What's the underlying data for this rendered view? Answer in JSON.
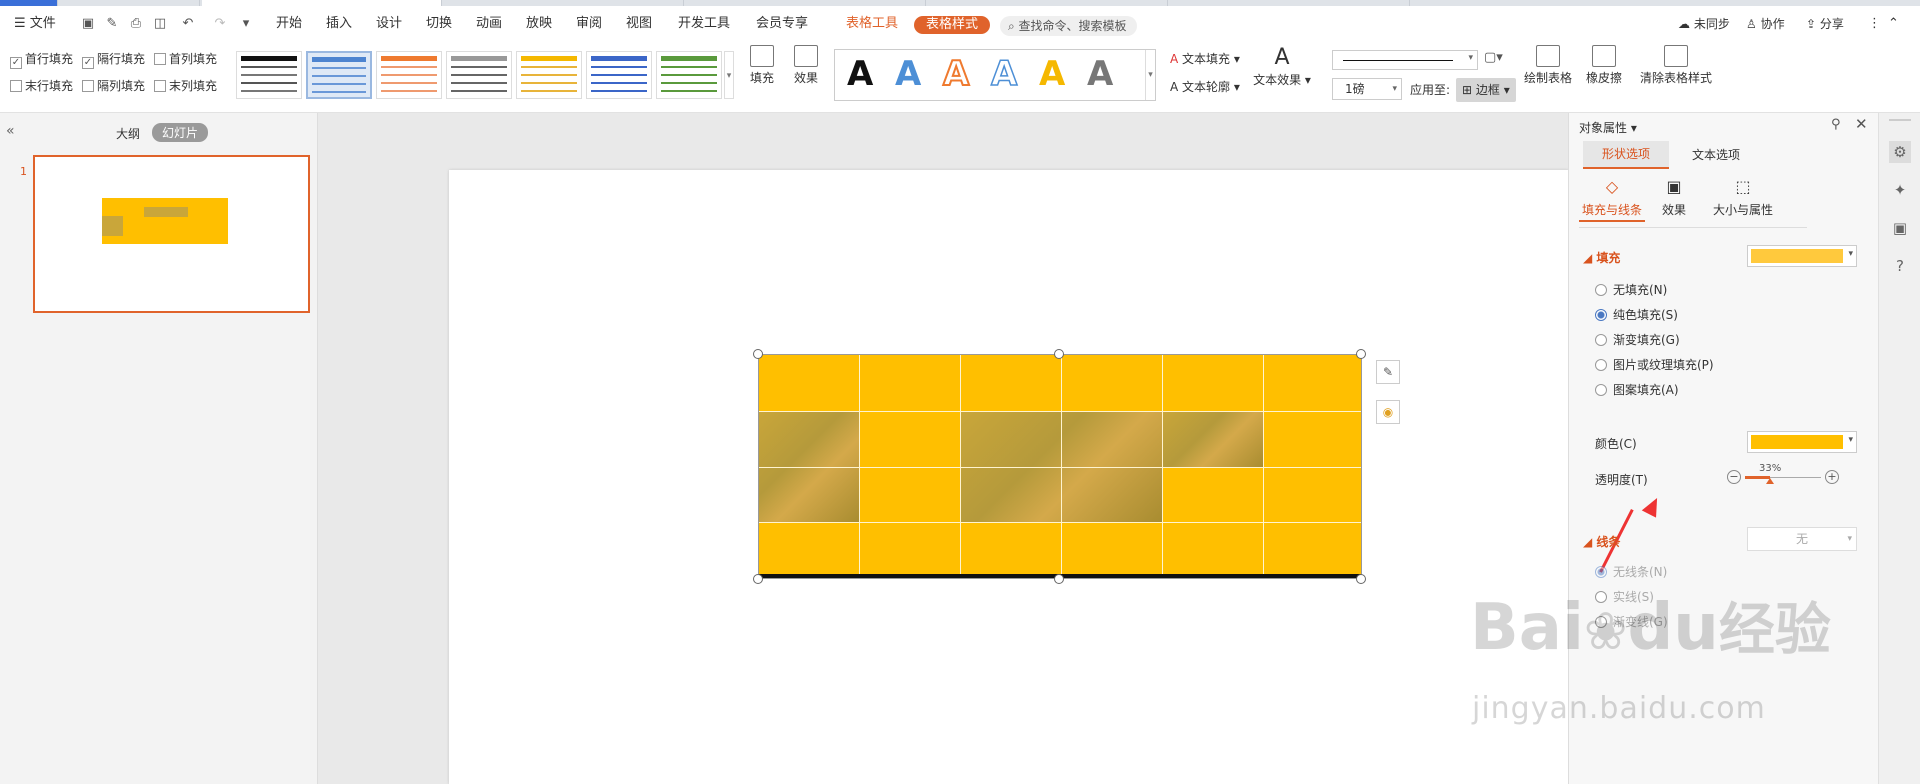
{
  "menu": {
    "file": "文件",
    "items": [
      "开始",
      "插入",
      "设计",
      "切换",
      "动画",
      "放映",
      "审阅",
      "视图",
      "开发工具",
      "会员专享"
    ],
    "table_tools": "表格工具",
    "table_style": "表格样式",
    "search": "查找命令、搜索模板",
    "sync": "未同步",
    "collab": "协作",
    "share": "分享"
  },
  "ribbon": {
    "checkboxes": [
      {
        "label": "首行填充",
        "checked": true
      },
      {
        "label": "隔行填充",
        "checked": true
      },
      {
        "label": "首列填充",
        "checked": false
      },
      {
        "label": "末行填充",
        "checked": false
      },
      {
        "label": "隔列填充",
        "checked": false
      },
      {
        "label": "末列填充",
        "checked": false
      }
    ],
    "fill": "填充",
    "effect": "效果",
    "text_fill": "文本填充",
    "text_outline": "文本轮廓",
    "text_effect": "文本效果",
    "line_weight": "1磅",
    "apply_to": "应用至:",
    "border": "边框",
    "draw_table": "绘制表格",
    "eraser": "橡皮擦",
    "clear_style": "清除表格样式",
    "big_a_colors": [
      "#111111",
      "#4d8fd6",
      "#ef7a2f",
      "#4d8fd6",
      "#f5b800",
      "#777777"
    ]
  },
  "left_panel": {
    "outline_tab": "大纲",
    "slides_tab": "幻灯片",
    "slide_number": "1"
  },
  "pane": {
    "title": "对象属性",
    "tab_shape": "形状选项",
    "tab_text": "文本选项",
    "sub_fill_line": "填充与线条",
    "sub_effect": "效果",
    "sub_size": "大小与属性",
    "fill_section": "填充",
    "fill_options": [
      "无填充(N)",
      "纯色填充(S)",
      "渐变填充(G)",
      "图片或纹理填充(P)",
      "图案填充(A)"
    ],
    "color_label": "颜色(C)",
    "transparency_label": "透明度(T)",
    "transparency_value": "33%",
    "line_section": "线条",
    "line_value": "无",
    "line_options": [
      "无线条(N)",
      "实线(S)",
      "渐变线(G)"
    ],
    "fill_color": "#ffc93d",
    "solid_color": "#ffbf00"
  },
  "watermark": {
    "brand": "Bai",
    "brand2": "du",
    "cn": "经验",
    "url": "jingyan.baidu.com"
  }
}
